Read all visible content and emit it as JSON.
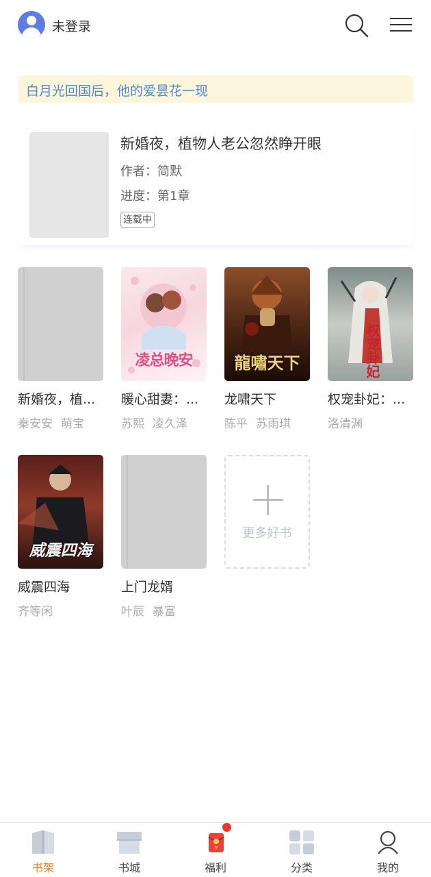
{
  "header": {
    "login_text": "未登录",
    "avatar_icon": "user-avatar-icon",
    "search_icon": "search-icon",
    "menu_icon": "hamburger-menu-icon"
  },
  "banner": {
    "text": "白月光回国后，他的爱昙花一现",
    "color": "#4a8bd1",
    "background": "#fdf6dc"
  },
  "recent": {
    "title": "新婚夜，植物人老公忽然睁开眼",
    "author": "作者：简默",
    "progress": "进度：第1章",
    "status": "连载中"
  },
  "books": [
    {
      "name": "新婚夜，植...",
      "tags": [
        "秦安安",
        "萌宝"
      ],
      "cover": "blank"
    },
    {
      "name": "暖心甜妻：...",
      "tags": [
        "苏熙",
        "凌久泽"
      ],
      "cover": "凌总晚安"
    },
    {
      "name": "龙啸天下",
      "tags": [
        "陈平",
        "苏雨琪"
      ],
      "cover": "龍嘯天下"
    },
    {
      "name": "权宠卦妃：...",
      "tags": [
        "洛清渊"
      ],
      "cover": "权宠卦妃"
    },
    {
      "name": "威震四海",
      "tags": [
        "齐等闲"
      ],
      "cover": "威震四海"
    },
    {
      "name": "上门龙婿",
      "tags": [
        "叶辰",
        "暴富"
      ],
      "cover": "blank"
    }
  ],
  "more_books": {
    "label": "更多好书",
    "icon": "plus-icon"
  },
  "tabs": [
    {
      "label": "书架",
      "icon": "bookshelf-icon",
      "active": true
    },
    {
      "label": "书城",
      "icon": "bookstore-icon",
      "active": false
    },
    {
      "label": "福利",
      "icon": "red-envelope-icon",
      "active": false
    },
    {
      "label": "分类",
      "icon": "category-grid-icon",
      "active": false
    },
    {
      "label": "我的",
      "icon": "profile-icon",
      "active": false
    }
  ],
  "colors": {
    "accent": "#f07d2a",
    "badge": "#e8362c"
  }
}
